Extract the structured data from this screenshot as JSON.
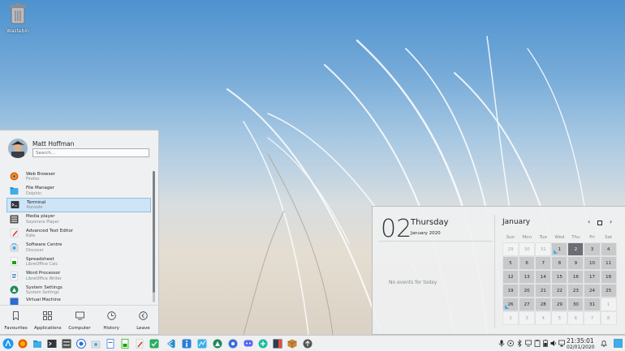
{
  "desktop": {
    "icons": [
      {
        "label": "Wastebin",
        "icon": "wastebin-icon"
      }
    ]
  },
  "launcher": {
    "user": "Matt Hoffman",
    "search_placeholder": "Search...",
    "apps": [
      {
        "name": "Web Browser",
        "sub": "Firefox",
        "icon": "firefox-icon",
        "color": "#e66000"
      },
      {
        "name": "File Manager",
        "sub": "Dolphin",
        "icon": "folder-icon",
        "color": "#3daee9"
      },
      {
        "name": "Terminal",
        "sub": "Konsole",
        "icon": "terminal-icon",
        "color": "#31363b"
      },
      {
        "name": "Media player",
        "sub": "Sayonara Player",
        "icon": "media-player-icon",
        "color": "#4d4d4d"
      },
      {
        "name": "Advanced Text Editor",
        "sub": "Kate",
        "icon": "text-editor-icon",
        "color": "#e4e4e4"
      },
      {
        "name": "Software Centre",
        "sub": "Discover",
        "icon": "software-centre-icon",
        "color": "#3daee9"
      },
      {
        "name": "Spreadsheet",
        "sub": "LibreOffice Calc",
        "icon": "spreadsheet-icon",
        "color": "#18a303"
      },
      {
        "name": "Word Processor",
        "sub": "LibreOffice Writer",
        "icon": "word-processor-icon",
        "color": "#2a6fd6"
      },
      {
        "name": "System Settings",
        "sub": "System Settings",
        "icon": "settings-icon",
        "color": "#1e8a5a"
      },
      {
        "name": "Virtual Machine",
        "sub": "",
        "icon": "virtual-machine-icon",
        "color": "#2d6bd0"
      }
    ],
    "tabs": [
      {
        "label": "Favourites",
        "icon": "bookmark-icon"
      },
      {
        "label": "Applications",
        "icon": "grid-icon"
      },
      {
        "label": "Computer",
        "icon": "monitor-icon"
      },
      {
        "label": "History",
        "icon": "clock-icon"
      },
      {
        "label": "Leave",
        "icon": "arrow-left-icon"
      }
    ]
  },
  "calendar": {
    "day_number": "02",
    "weekday": "Thursday",
    "month_year": "January 2020",
    "no_events": "No events for today",
    "month": "January",
    "weekday_headers": [
      "Sun",
      "Mon",
      "Tue",
      "Wed",
      "Thu",
      "Fri",
      "Sat"
    ],
    "weeks": [
      [
        "29",
        "30",
        "31",
        "1",
        "2",
        "3",
        "4"
      ],
      [
        "5",
        "6",
        "7",
        "8",
        "9",
        "10",
        "11"
      ],
      [
        "12",
        "13",
        "14",
        "15",
        "16",
        "17",
        "18"
      ],
      [
        "19",
        "20",
        "21",
        "22",
        "23",
        "24",
        "25"
      ],
      [
        "26",
        "27",
        "28",
        "29",
        "30",
        "31",
        "1"
      ],
      [
        "2",
        "3",
        "4",
        "5",
        "6",
        "7",
        "8"
      ]
    ],
    "today": "2"
  },
  "taskbar": {
    "time": "21:35:01",
    "date": "02/01/2020",
    "accent": "#3daee9"
  }
}
